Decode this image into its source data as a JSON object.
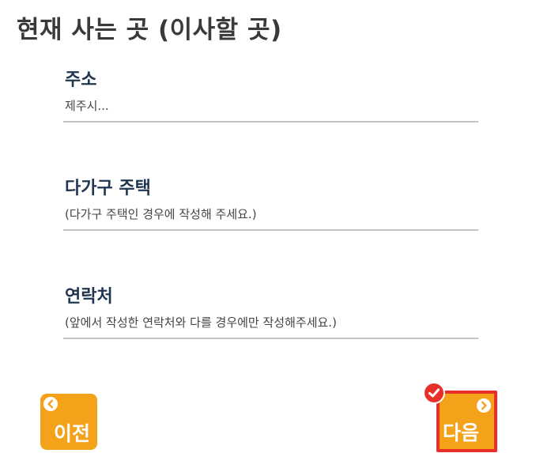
{
  "page": {
    "title": "현재 사는 곳 (이사할 곳)"
  },
  "form": {
    "address": {
      "label": "주소",
      "value": "",
      "placeholder": "제주시..."
    },
    "multi_family": {
      "label": "다가구 주택",
      "value": "",
      "placeholder": "(다가구 주택인 경우에 작성해 주세요.)"
    },
    "contact": {
      "label": "연락처",
      "value": "",
      "placeholder": "(앞에서 작성한 연락처와 다를 경우에만 작성해주세요.)"
    }
  },
  "navigation": {
    "prev_label": "이전",
    "next_label": "다음",
    "prev_icon": "chevron-left-circle-icon",
    "next_icon": "chevron-right-circle-icon",
    "selected_icon": "check-badge-icon"
  },
  "colors": {
    "button_bg": "#f4a21a",
    "highlight": "#e8302a",
    "label_text": "#1f3550",
    "title_text": "#3a3a3a",
    "underline": "#c4c4c4"
  }
}
